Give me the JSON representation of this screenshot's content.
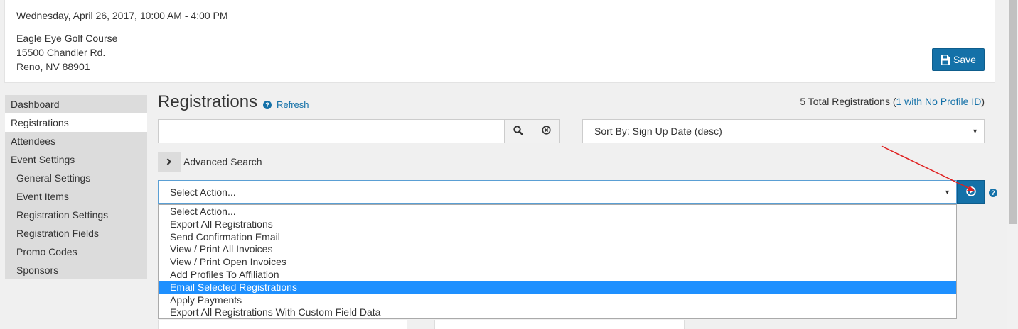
{
  "event": {
    "date": "Wednesday, April 26, 2017, 10:00 AM - 4:00 PM",
    "address_lines": [
      "Eagle Eye Golf Course",
      "15500 Chandler Rd.",
      "Reno, NV 88901"
    ],
    "save_label": "Save"
  },
  "sidebar": {
    "items": [
      {
        "label": "Dashboard"
      },
      {
        "label": "Registrations"
      },
      {
        "label": "Attendees"
      },
      {
        "label": "Event Settings"
      },
      {
        "label": "General Settings"
      },
      {
        "label": "Event Items"
      },
      {
        "label": "Registration Settings"
      },
      {
        "label": "Registration Fields"
      },
      {
        "label": "Promo Codes"
      },
      {
        "label": "Sponsors"
      }
    ],
    "active": "Registrations"
  },
  "registrations": {
    "title": "Registrations",
    "refresh_label": "Refresh",
    "total_prefix": "5 Total Registrations (",
    "total_link": "1 with No Profile ID",
    "total_suffix": ")",
    "search_value": "",
    "sort_value": "Sort By: Sign Up Date (desc)",
    "advanced_search_label": "Advanced Search",
    "action_selected": "Select Action...",
    "action_options": [
      "Select Action...",
      "Export All Registrations",
      "Send Confirmation Email",
      "View / Print All Invoices",
      "View / Print Open Invoices",
      "Add Profiles To Affiliation",
      "Email Selected Registrations",
      "Apply Payments",
      "Export All Registrations With Custom Field Data"
    ],
    "highlighted_option": "Email Selected Registrations"
  },
  "icons": {
    "save": "floppy-disk-icon",
    "help": "question-circle-icon",
    "search": "magnifier-icon",
    "clear": "times-circle-icon",
    "expand": "chevron-right-icon",
    "go": "play-circle-icon",
    "dropdown": "caret-down-icon"
  },
  "colors": {
    "primary": "#1471a8",
    "highlight": "#1e90ff",
    "annotation_arrow": "#e02020"
  }
}
